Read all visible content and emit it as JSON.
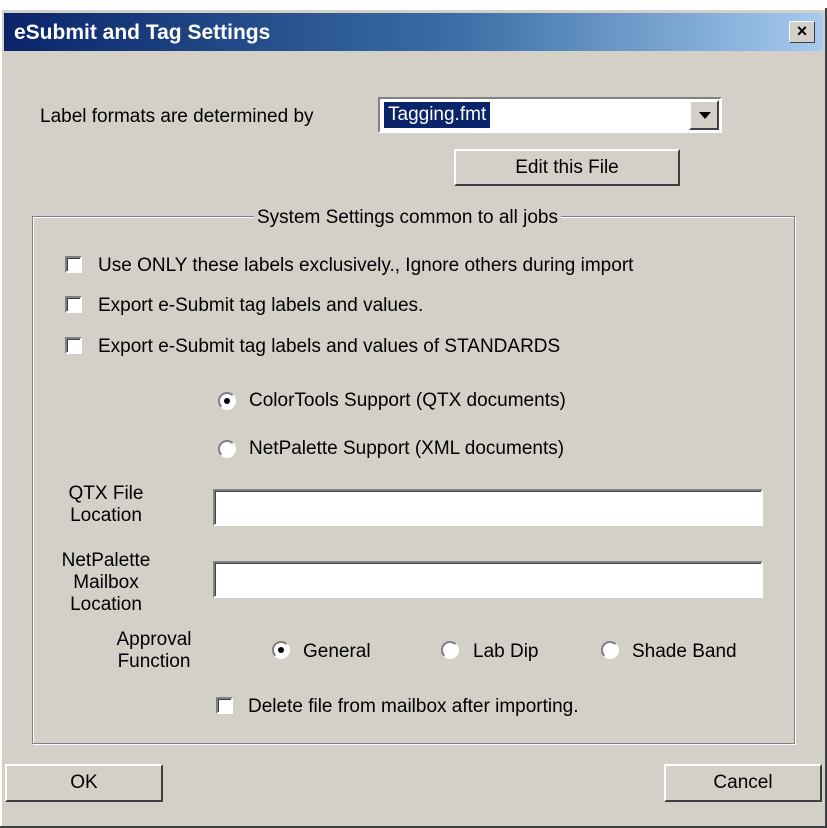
{
  "window": {
    "title": "eSubmit and Tag Settings",
    "close_label": "×"
  },
  "format": {
    "label": "Label formats are determined by",
    "selected": "Tagging.fmt",
    "edit_button": "Edit this File"
  },
  "system": {
    "group_title": "System Settings common to all jobs",
    "checkboxes": [
      {
        "label": "Use ONLY these labels exclusively., Ignore others during import",
        "checked": false
      },
      {
        "label": "Export e-Submit tag labels and values.",
        "checked": false
      },
      {
        "label": "Export e-Submit tag labels and values of STANDARDS",
        "checked": false
      }
    ],
    "support": [
      {
        "label": "ColorTools Support (QTX documents)",
        "selected": true
      },
      {
        "label": "NetPalette Support (XML documents)",
        "selected": false
      }
    ],
    "qtx_label": "QTX File Location",
    "qtx_value": "",
    "mailbox_label": "NetPalette Mailbox Location",
    "mailbox_value": "",
    "approval_label": "Approval Function",
    "approval_options": [
      {
        "label": "General",
        "selected": true
      },
      {
        "label": "Lab Dip",
        "selected": false
      },
      {
        "label": "Shade Band",
        "selected": false
      }
    ],
    "delete_label": "Delete file from mailbox after importing.",
    "delete_checked": false
  },
  "footer": {
    "ok": "OK",
    "cancel": "Cancel"
  }
}
